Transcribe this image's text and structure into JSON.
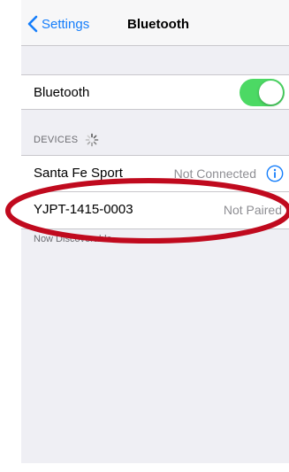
{
  "nav": {
    "back_label": "Settings",
    "title": "Bluetooth",
    "back_icon": "chevron-left-icon"
  },
  "bluetooth": {
    "label": "Bluetooth",
    "enabled": true
  },
  "devices": {
    "header": "DEVICES",
    "spinner_icon": "activity-spinner-icon",
    "items": [
      {
        "name": "Santa Fe Sport",
        "status": "Not Connected",
        "info_icon": "info-icon"
      },
      {
        "name": "YJPT-1415-0003",
        "status": "Not Paired"
      }
    ],
    "footer": "Now Discoverable"
  },
  "colors": {
    "accent": "#157efb",
    "toggle_on": "#4cd964",
    "highlight": "#c00a1e",
    "background": "#efeff4"
  }
}
